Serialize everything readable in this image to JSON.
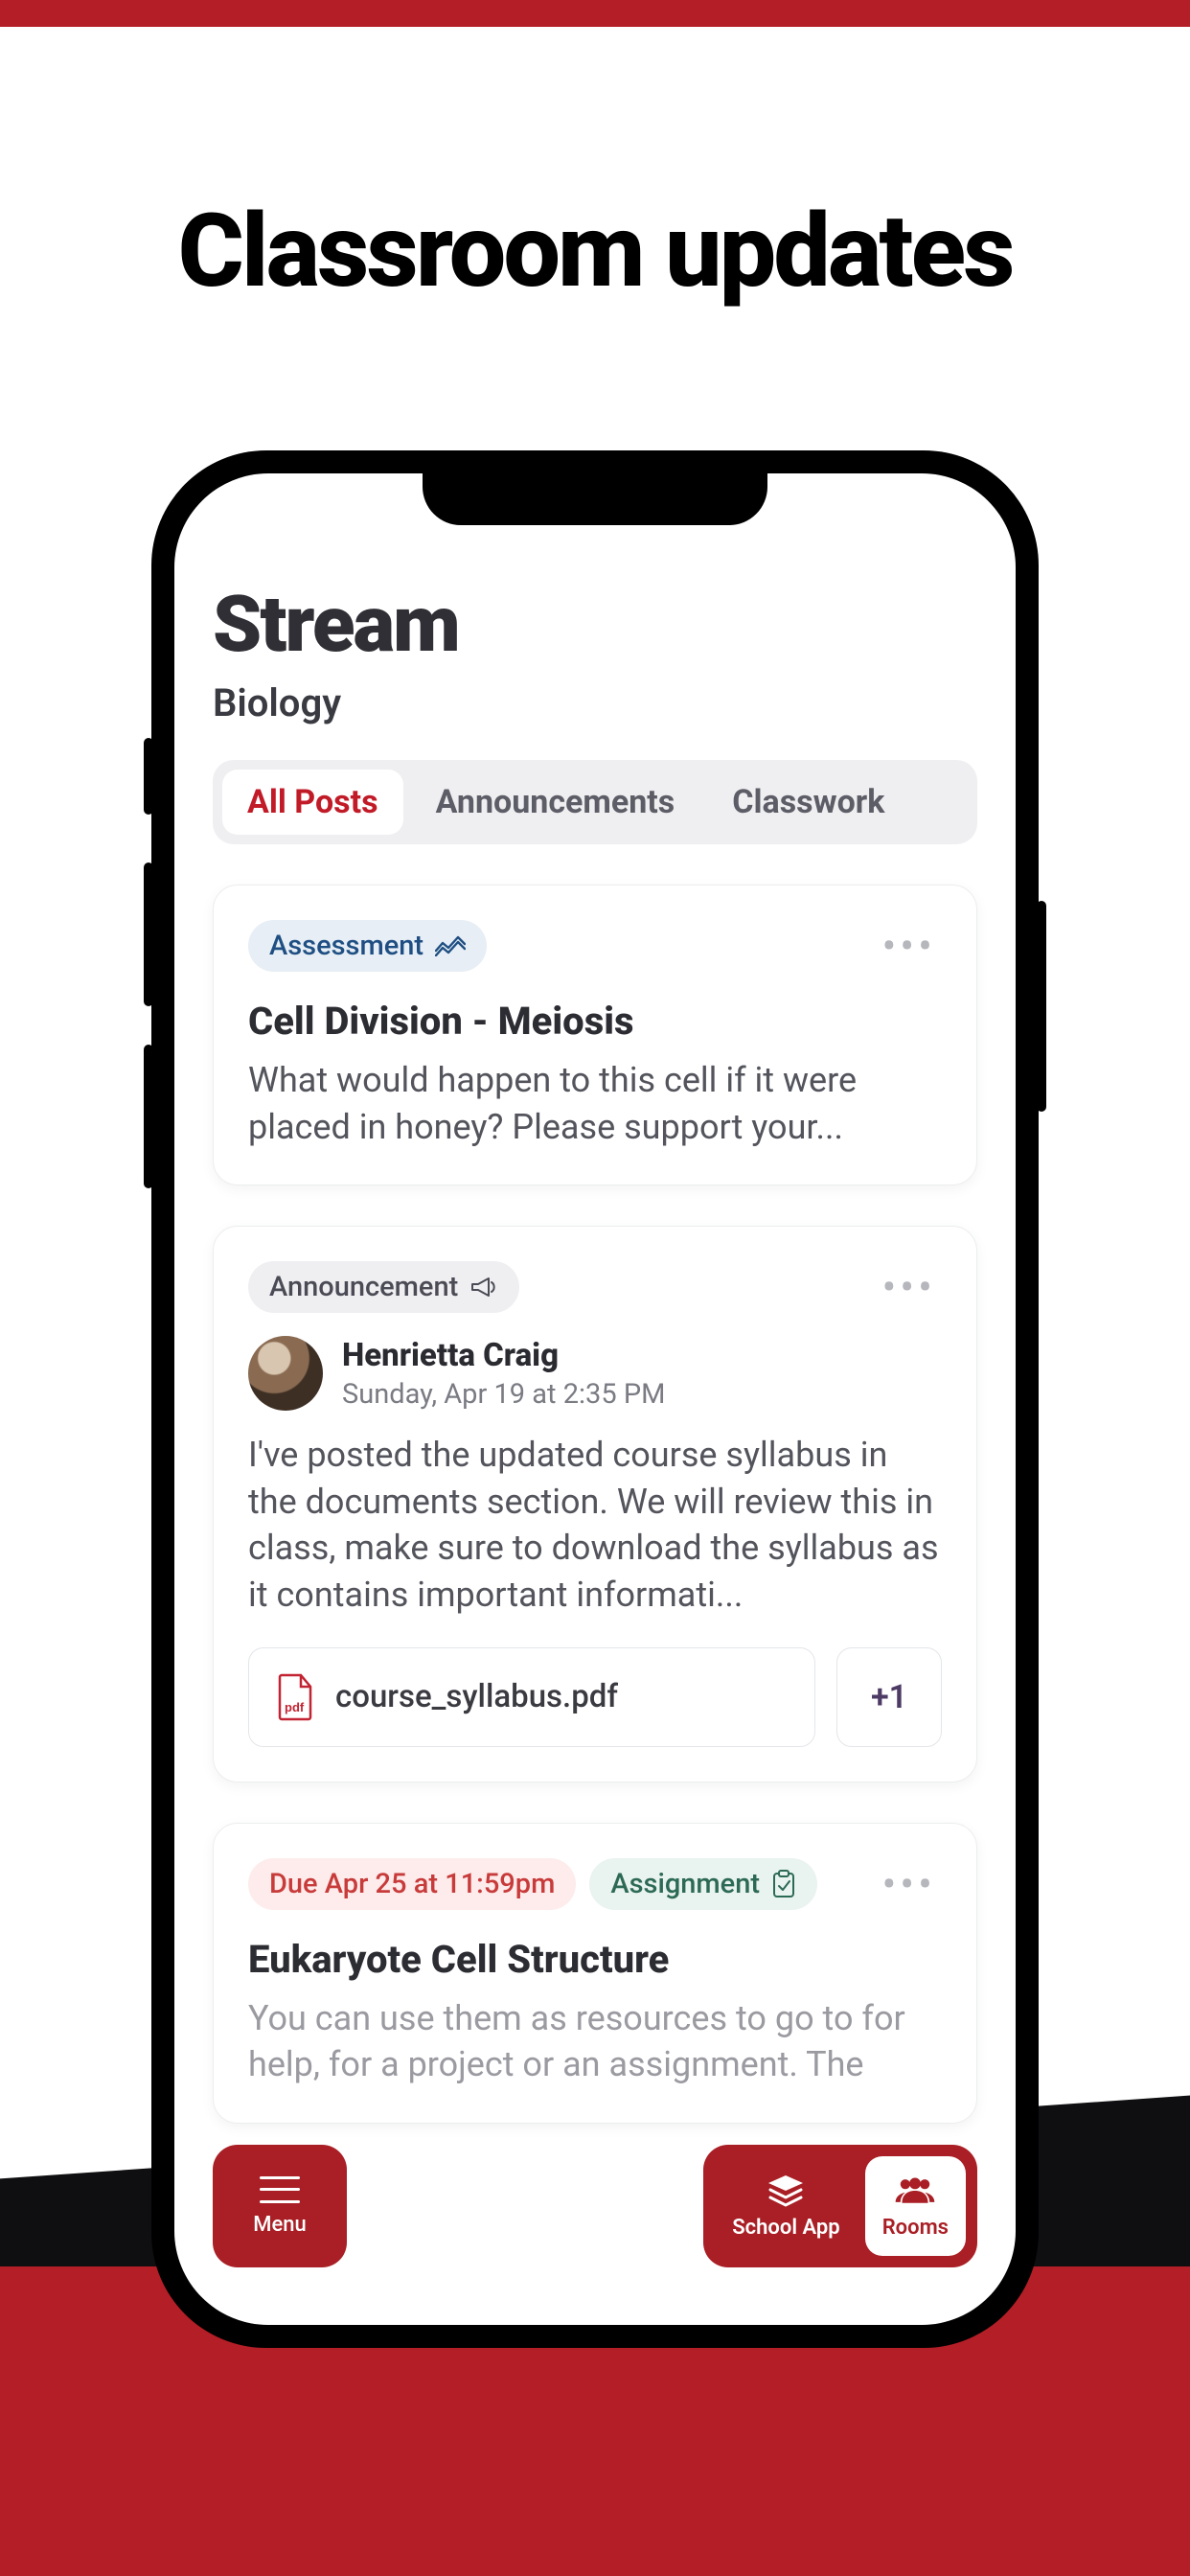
{
  "page": {
    "headline": "Classroom updates"
  },
  "stream": {
    "title": "Stream",
    "subject": "Biology"
  },
  "tabs": {
    "all_posts": "All Posts",
    "announcements": "Announcements",
    "classwork": "Classwork"
  },
  "cards": {
    "assessment": {
      "chip": "Assessment",
      "title": "Cell Division - Meiosis",
      "body": "What would happen to this cell if it were placed in honey? Please support your..."
    },
    "announcement": {
      "chip": "Announcement",
      "author": "Henrietta Craig",
      "date": "Sunday, Apr 19 at 2:35 PM",
      "body": "I've posted the updated course syllabus in the documents section. We will review this in class, make sure to download the syllabus as it contains important informati...",
      "attachment_name": "course_syllabus.pdf",
      "more_attachments": "+1"
    },
    "assignment": {
      "due_chip": "Due Apr 25 at 11:59pm",
      "chip": "Assignment",
      "title": "Eukaryote Cell Structure",
      "body": "You can use them as resources to go to for help, for a project or an assignment. The"
    }
  },
  "fab": {
    "menu": "Menu",
    "school_app": "School App",
    "rooms": "Rooms"
  }
}
